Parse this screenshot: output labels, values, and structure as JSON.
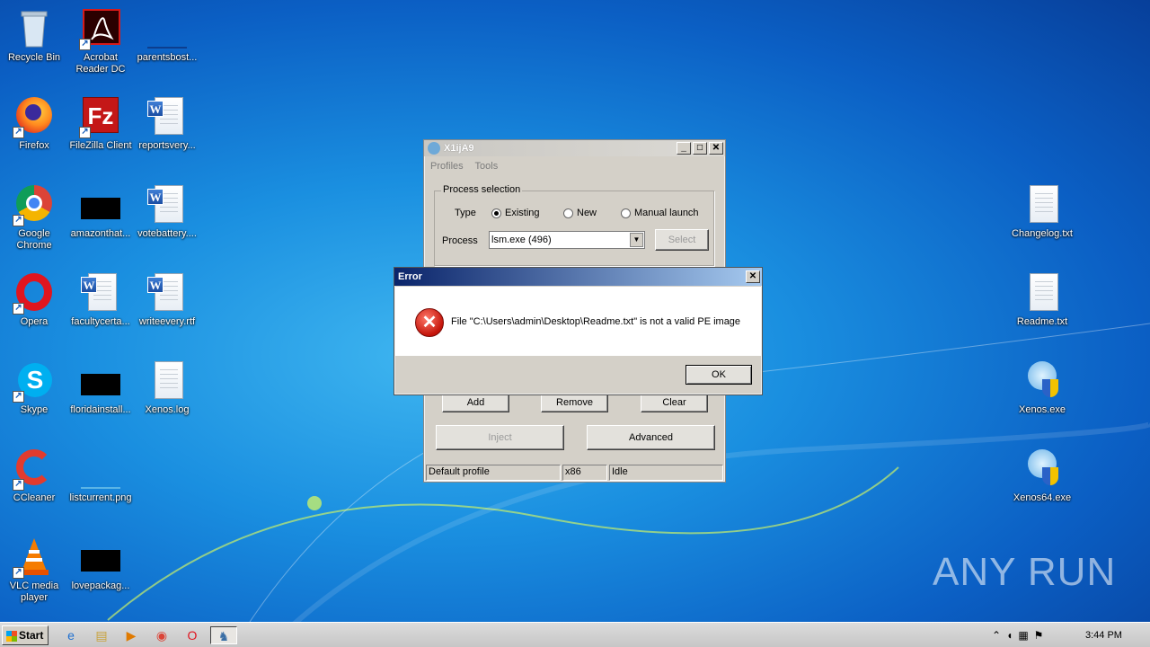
{
  "desktop": {
    "icons_left": [
      {
        "label": "Recycle Bin"
      },
      {
        "label": "Acrobat Reader DC"
      },
      {
        "label": "parentsbost..."
      },
      {
        "label": "Firefox"
      },
      {
        "label": "FileZilla Client"
      },
      {
        "label": "reportsvery..."
      },
      {
        "label": "Google Chrome"
      },
      {
        "label": "amazonthat..."
      },
      {
        "label": "votebattery...."
      },
      {
        "label": "Opera"
      },
      {
        "label": "facultycerta..."
      },
      {
        "label": "writeevery.rtf"
      },
      {
        "label": "Skype"
      },
      {
        "label": "floridainstall..."
      },
      {
        "label": "Xenos.log"
      },
      {
        "label": "CCleaner"
      },
      {
        "label": "listcurrent.png"
      },
      {
        "label": "VLC media player"
      },
      {
        "label": "lovepackag..."
      }
    ],
    "icons_right": [
      {
        "label": "Changelog.txt"
      },
      {
        "label": "Readme.txt"
      },
      {
        "label": "Xenos.exe"
      },
      {
        "label": "Xenos64.exe"
      }
    ],
    "watermark": "ANY RUN"
  },
  "xenos_window": {
    "title": "X1ijA9",
    "menu": [
      "Profiles",
      "Tools"
    ],
    "group_title": "Process selection",
    "type_label": "Type",
    "radio_existing": "Existing",
    "radio_new": "New",
    "radio_manual": "Manual launch",
    "process_label": "Process",
    "process_value": "lsm.exe (496)",
    "select_button": "Select",
    "add_button": "Add",
    "remove_button": "Remove",
    "clear_button": "Clear",
    "inject_button": "Inject",
    "advanced_button": "Advanced",
    "status": [
      "Default profile",
      "x86",
      "Idle"
    ]
  },
  "error_dialog": {
    "title": "Error",
    "message": "File \"C:\\Users\\admin\\Desktop\\Readme.txt\" is not a valid PE image",
    "ok_button": "OK",
    "close_glyph": "✕"
  },
  "taskbar": {
    "start_label": "Start",
    "clock": "3:44 PM"
  }
}
